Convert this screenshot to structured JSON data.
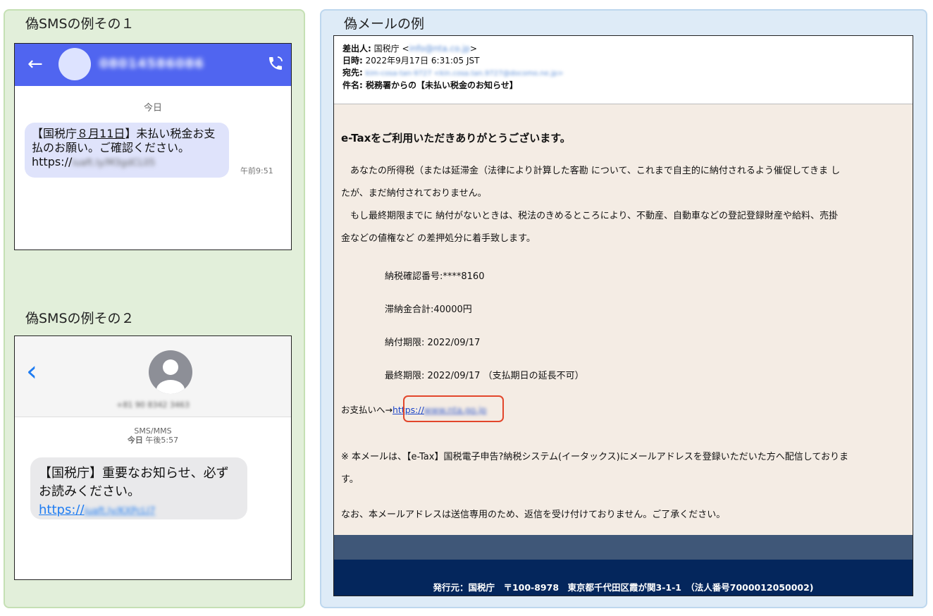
{
  "left_panel": {
    "sms1": {
      "title": "偽SMSの例その１",
      "sender_number": "08014586086",
      "date": "今日",
      "msg_line1_a": "【国税庁",
      "msg_line1_u": "８月11日",
      "msg_line1_b": "】未払い税金お支",
      "msg_line2": "払のお願い。ご確認ください。",
      "msg_url_prefix": "https://",
      "msg_url_blurred": "iuaft.ly/M3gdCL05",
      "time": "午前9:51"
    },
    "sms2": {
      "title": "偽SMSの例その２",
      "sender_number": "+81 90 8342 3463",
      "type": "SMS/MMS",
      "time_label": "今日",
      "time_value": " 午後5:57",
      "msg_text": "【国税庁】重要なお知らせ、必ずお読みください。",
      "msg_url": "https://",
      "msg_url_blurred": "iuaft.ly/KXPcLJ7"
    }
  },
  "email": {
    "title": "偽メールの例",
    "from_label": "差出人:",
    "from_value": " 国税庁 <",
    "from_email": "info@nta.co.jp",
    "from_close": ">",
    "date_label": "日時:",
    "date_value": " 2022年9月17日 6:31:05 JST",
    "to_label": "宛先:",
    "to_value": "kim-cosa-tan-9727 <kin.cosa.tan.9727@docomo.ne.jp>",
    "subject_label": "件名:",
    "subject_value": " 税務署からの【未払い税金のお知らせ】",
    "heading": "e-Taxをご利用いただきありがとうございます。",
    "para1a": "　あなたの所得税（または延滞金（法律により計算した客勘 について、これまで自主的に納付されるよう催促してきま し",
    "para1b": "たが、まだ納付されておりません。",
    "para2a": "　もし最終期限までに 納付がないときは、税法のきめるところにより、不動産、自動車などの登記登録財産や給料、売掛",
    "para2b": "金などの値権など の差押処分に着手致します。",
    "detail1": "納税確認番号:****8160",
    "detail2": "滞納金合計:40000円",
    "detail3": "納付期限: 2022/09/17",
    "detail4": "最終期限: 2022/09/17 （支払期日の延長不可）",
    "link_prefix": "お支払いへ→",
    "link_url": "https://",
    "link_blurred": "www.nta.go.jp",
    "note1a": "※ 本メールは、【e-Tax】国税電子申告?納税システム(イータックス)にメールアドレスを登録いただいた方へ配信しておりま",
    "note1b": "す。",
    "note2": "なお、本メールアドレスは送信専用のため、返信を受け付けておりません。ご了承ください。",
    "footer": "発行元：国税庁　〒100-8978　東京都千代田区霞が関3-1-1　（法人番号7000012050002)"
  },
  "colors": {
    "left_bg": "#e2efda",
    "right_bg": "#deebf7",
    "sms1_header": "#5065f0",
    "sms1_bubble": "#dfe3fb",
    "ios_blue": "#1e7cf2",
    "email_body": "#f4ece4",
    "footer_mid": "#3f5778",
    "footer_dark": "#04265c",
    "highlight": "#e2462b"
  },
  "icons": [
    "arrow-left-icon",
    "phone-icon",
    "chevron-left-icon",
    "person-icon"
  ]
}
